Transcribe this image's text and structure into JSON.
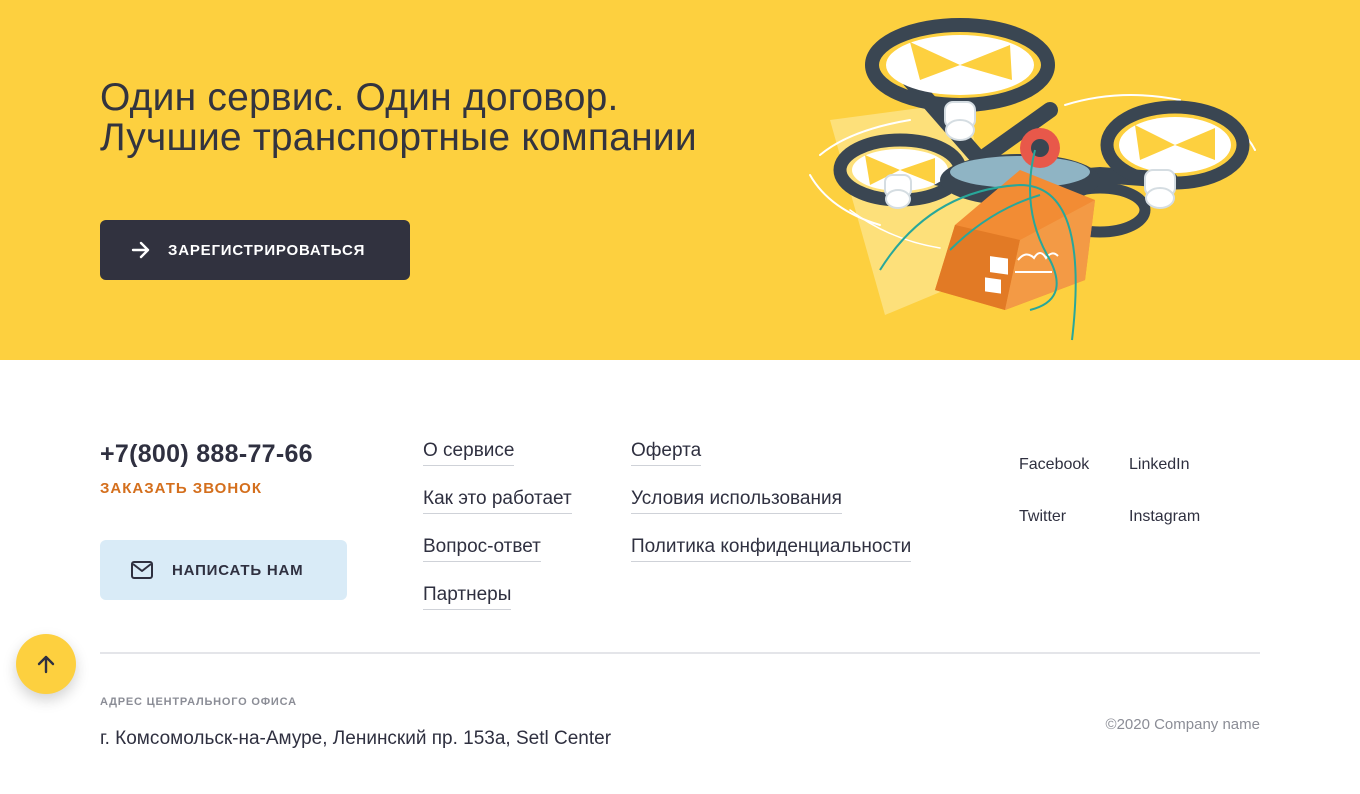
{
  "hero": {
    "title_line1": "Один сервис. Один договор.",
    "title_line2": "Лучшие транспортные компании",
    "register_label": "ЗАРЕГИСТРИРОВАТЬСЯ",
    "background_color": "#fdd03f",
    "button_color": "#31323f"
  },
  "contact": {
    "phone": "+7(800) 888-77-66",
    "callback_label": "ЗАКАЗАТЬ ЗВОНОК",
    "write_label": "НАПИСАТЬ НАМ",
    "callback_color": "#d46f1d",
    "write_button_color": "#d9ebf7"
  },
  "nav": {
    "col1": [
      "О сервисе",
      "Как это работает",
      "Вопрос-ответ",
      "Партнеры"
    ],
    "col2": [
      "Оферта",
      "Условия использования",
      "Политика конфиденциальности"
    ]
  },
  "social": {
    "facebook": "Facebook",
    "linkedin": "LinkedIn",
    "twitter": "Twitter",
    "instagram": "Instagram"
  },
  "office": {
    "label": "АДРЕС ЦЕНТРАЛЬНОГО ОФИСА",
    "address": "г. Комсомольск-на-Амуре, Ленинский пр. 153а, Setl Center"
  },
  "copyright": "©2020 Company name",
  "icons": {
    "register": "arrow-right-icon",
    "write": "mail-icon",
    "scroll_top": "arrow-up-icon",
    "illustration": "delivery-drone-illustration"
  }
}
